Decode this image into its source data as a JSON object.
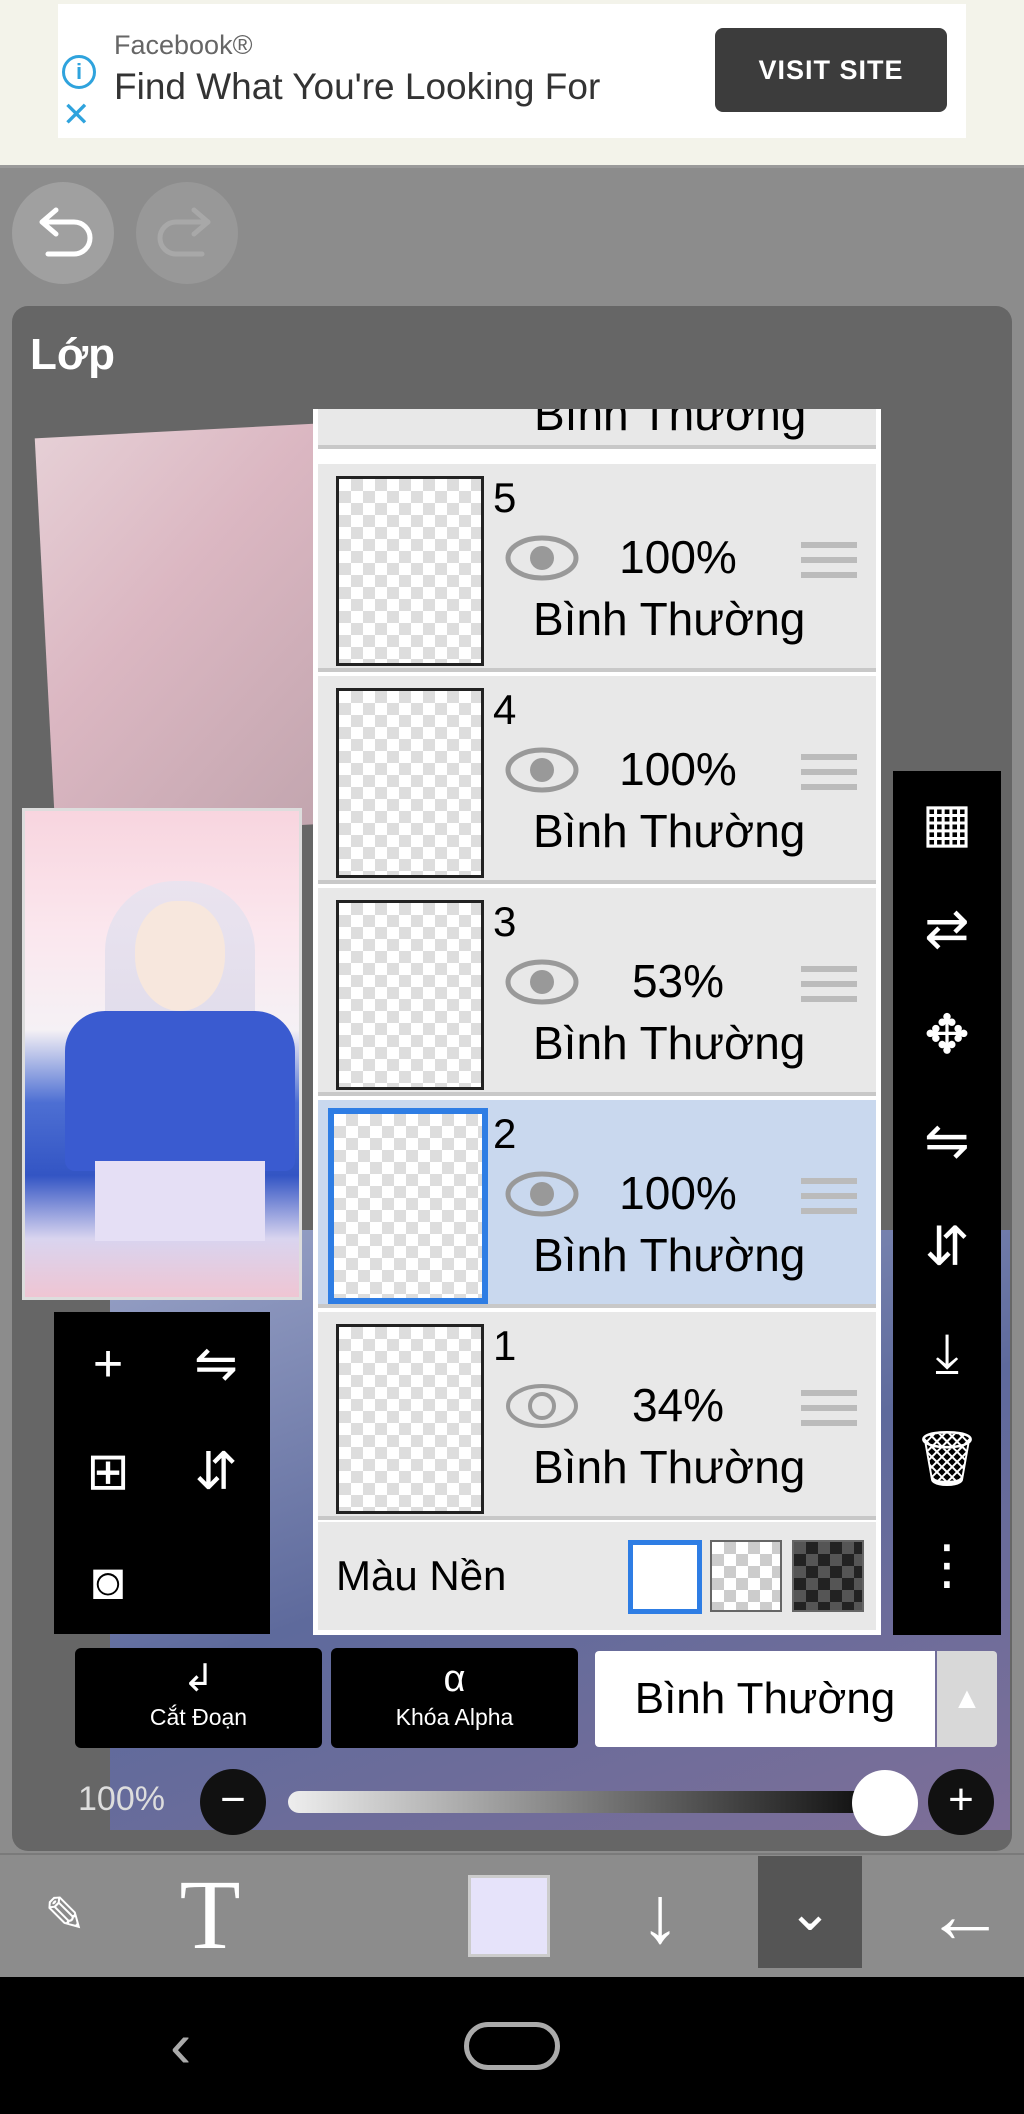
{
  "ad": {
    "source": "Facebook®",
    "headline": "Find What You're Looking For",
    "info_glyph": "i",
    "close_glyph": "✕",
    "cta": "VISIT SITE"
  },
  "toolbar_top": {
    "undo_icon": "undo-icon",
    "redo_icon": "redo-icon"
  },
  "panel": {
    "title": "Lớp"
  },
  "layers": [
    {
      "number": "5",
      "opacity": "100%",
      "mode": "Bình Thường",
      "visible": true,
      "selected": false
    },
    {
      "number": "4",
      "opacity": "100%",
      "mode": "Bình Thường",
      "visible": true,
      "selected": false
    },
    {
      "number": "3",
      "opacity": "53%",
      "mode": "Bình Thường",
      "visible": true,
      "selected": false
    },
    {
      "number": "2",
      "opacity": "100%",
      "mode": "Bình Thường",
      "visible": true,
      "selected": true
    },
    {
      "number": "1",
      "opacity": "34%",
      "mode": "Bình Thường",
      "visible": false,
      "selected": false
    }
  ],
  "partial_layer_mode": "Bình Thường",
  "background_row": {
    "label": "Màu Nền",
    "options": [
      "white",
      "transparent",
      "dark-checker"
    ],
    "selected": "white"
  },
  "left_tools": [
    {
      "icon": "add-layer-icon",
      "glyph": "+"
    },
    {
      "icon": "flip-horizontal-icon",
      "glyph": "⇋"
    },
    {
      "icon": "add-layer-from-image-icon",
      "glyph": "⊞"
    },
    {
      "icon": "flip-vertical-icon",
      "glyph": "⇵"
    },
    {
      "icon": "camera-icon",
      "glyph": "◙"
    }
  ],
  "right_tools": [
    {
      "icon": "transparency-icon",
      "glyph": "▦"
    },
    {
      "icon": "transform-icon",
      "glyph": "⇄"
    },
    {
      "icon": "move-icon",
      "glyph": "✥"
    },
    {
      "icon": "flip-h-icon",
      "glyph": "⇋"
    },
    {
      "icon": "flip-v-icon",
      "glyph": "⇵"
    },
    {
      "icon": "merge-down-icon",
      "glyph": "⤓"
    },
    {
      "icon": "trash-icon",
      "glyph": "🗑"
    },
    {
      "icon": "more-icon",
      "glyph": "⋮"
    }
  ],
  "actions": {
    "cut_icon": "↲",
    "cut_label": "Cắt Đoạn",
    "alpha_icon": "α",
    "alpha_label": "Khóa Alpha",
    "blend_mode": "Bình Thường",
    "blend_arrow": "▲"
  },
  "opacity": {
    "label": "100%",
    "value": 1.0,
    "minus": "−",
    "plus": "+"
  },
  "bottom_toolbar": {
    "brush_glyph": "✎",
    "text_glyph": "T",
    "current_color": "#e6e3fa",
    "down_glyph": "↓",
    "collapse_glyph": "⌄",
    "back_glyph": "←"
  },
  "navbar": {
    "back_glyph": "‹"
  },
  "colors": {
    "accent": "#2e7de4",
    "panel": "#666666",
    "selected_row": "#c9d8ee"
  }
}
